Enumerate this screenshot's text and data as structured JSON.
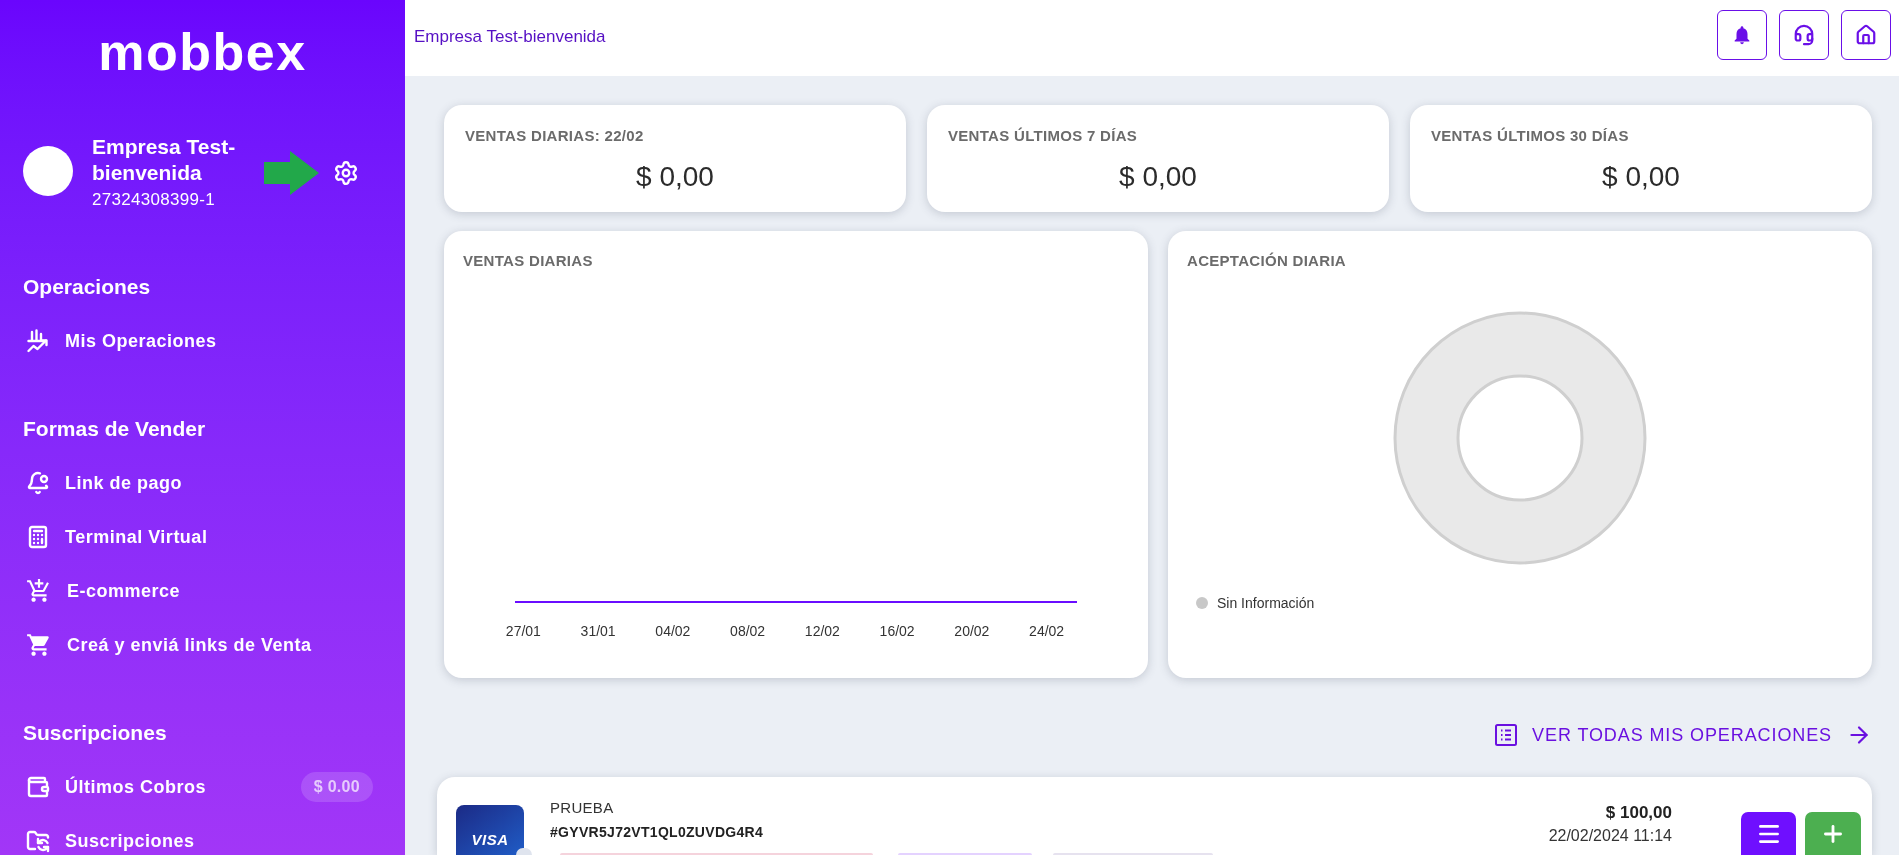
{
  "sidebar": {
    "logo": "mobbex",
    "account": {
      "name": "Empresa Test-bienvenida",
      "id": "27324308399-1"
    },
    "sections": [
      {
        "title": "Operaciones",
        "items": [
          {
            "label": "Mis Operaciones"
          }
        ]
      },
      {
        "title": "Formas de Vender",
        "items": [
          {
            "label": "Link de pago"
          },
          {
            "label": "Terminal Virtual"
          },
          {
            "label": "E-commerce"
          },
          {
            "label": "Creá y enviá links de Venta"
          }
        ]
      },
      {
        "title": "Suscripciones",
        "items": [
          {
            "label": "Últimos Cobros",
            "badge": "$ 0.00"
          },
          {
            "label": "Suscripciones"
          }
        ]
      }
    ]
  },
  "header": {
    "title": "Empresa Test-bienvenida"
  },
  "stats": [
    {
      "title": "VENTAS DIARIAS: 22/02",
      "value": "$ 0,00"
    },
    {
      "title": "VENTAS ÚLTIMOS 7 DÍAS",
      "value": "$ 0,00"
    },
    {
      "title": "VENTAS ÚLTIMOS 30 DÍAS",
      "value": "$ 0,00"
    }
  ],
  "sales_chart": {
    "title": "VENTAS DIARIAS",
    "x_labels": [
      "27/01",
      "31/01",
      "04/02",
      "08/02",
      "12/02",
      "16/02",
      "20/02",
      "24/02"
    ]
  },
  "acceptance_chart": {
    "title": "ACEPTACIÓN DIARIA",
    "legend": [
      {
        "label": "Sin Información",
        "color": "#c8c8c8"
      }
    ]
  },
  "all_operations_link": "VER TODAS MIS OPERACIONES",
  "operations": [
    {
      "card_brand": "VISA",
      "description": "PRUEBA",
      "id": "#GYVR5J72VT1QL0ZUVDG4R4",
      "amount": "$ 100,00",
      "date": "22/02/2024 11:14"
    }
  ]
}
